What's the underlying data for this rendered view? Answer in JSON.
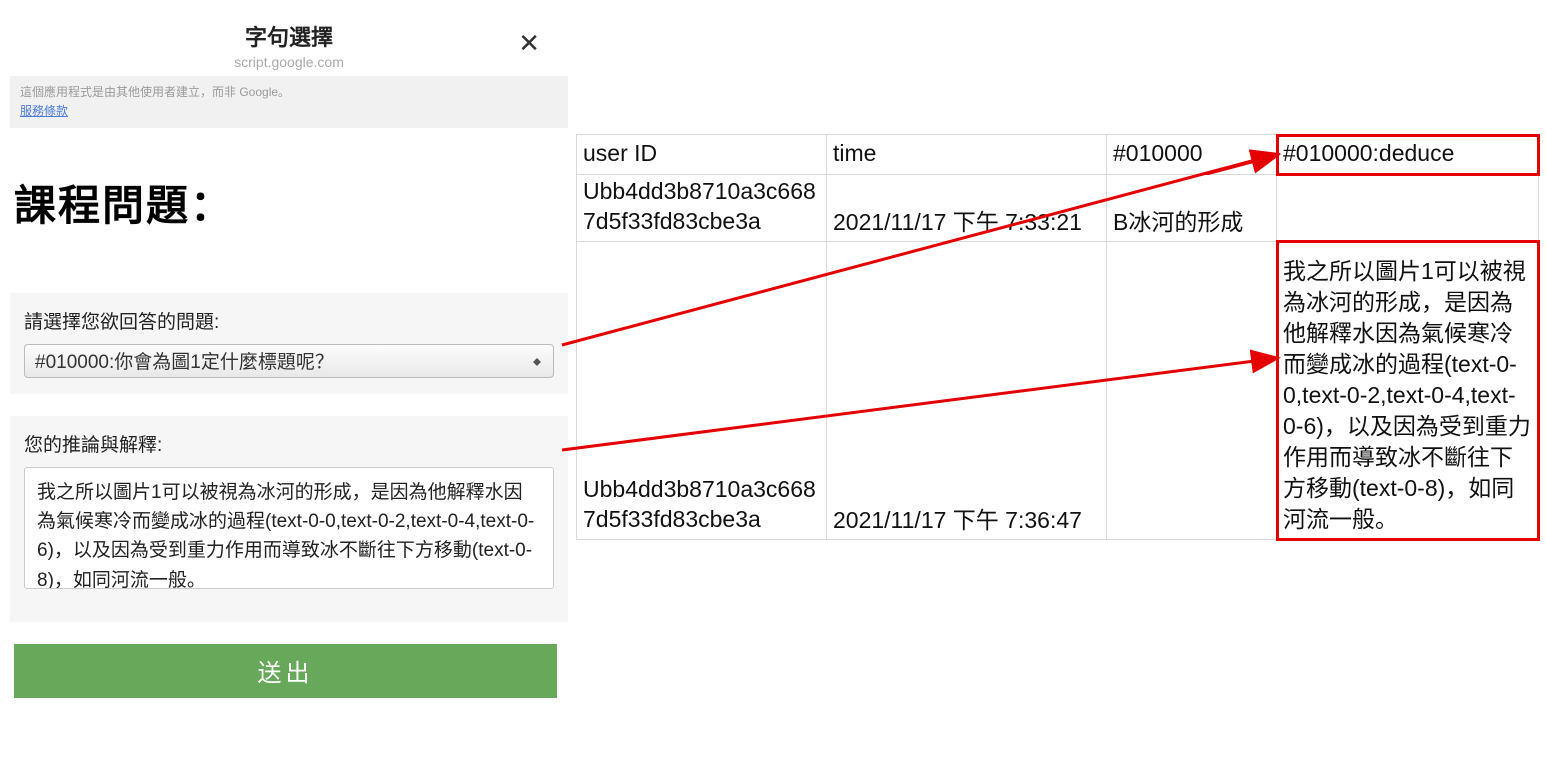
{
  "header": {
    "title": "字句選擇",
    "subtitle": "script.google.com",
    "close": "✕"
  },
  "notice": {
    "text": "這個應用程式是由其他使用者建立，而非 Google。",
    "tos": "服務條款"
  },
  "main": {
    "heading": "課程問題："
  },
  "form": {
    "selectLabel": "請選擇您欲回答的問題:",
    "selectValue": "#010000:你會為圖1定什麼標題呢？",
    "explainLabel": "您的推論與解釋:",
    "explainValue": "我之所以圖片1可以被視為冰河的形成，是因為他解釋水因為氣候寒冷而變成冰的過程(text-0-0,text-0-2,text-0-4,text-0-6)，以及因為受到重力作用而導致冰不斷往下方移動(text-0-8)，如同河流一般。",
    "submit": "送出"
  },
  "table": {
    "headers": {
      "userId": "user ID",
      "time": "time",
      "code": "#010000",
      "deduce": "#010000:deduce"
    },
    "rows": [
      {
        "userId": "Ubb4dd3b8710a3c6687d5f33fd83cbe3a",
        "time": "2021/11/17 下午 7:33:21",
        "code": "B冰河的形成",
        "deduce": ""
      },
      {
        "userId": "Ubb4dd3b8710a3c6687d5f33fd83cbe3a",
        "time": "2021/11/17 下午 7:36:47",
        "code": "",
        "deduce": "我之所以圖片1可以被視為冰河的形成，是因為他解釋水因為氣候寒冷而變成冰的過程(text-0-0,text-0-2,text-0-4,text-0-6)，以及因為受到重力作用而導致冰不斷往下方移動(text-0-8)，如同河流一般。"
      }
    ]
  }
}
